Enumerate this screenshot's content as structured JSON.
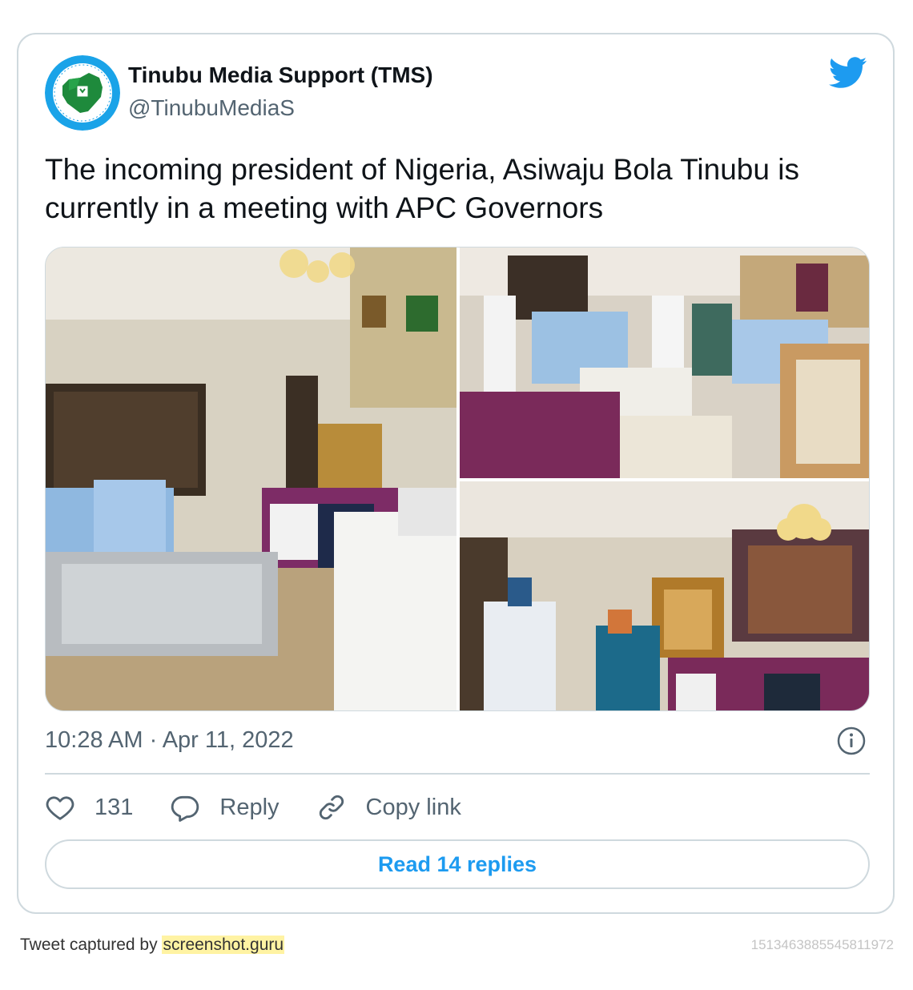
{
  "author": {
    "name": "Tinubu Media Support (TMS)",
    "handle": "@TinubuMediaS",
    "avatar_icon": "nigeria-map-emblem-icon"
  },
  "tweet": {
    "text": "The incoming president of Nigeria, Asiwaju Bola Tinubu is currently in a meeting with APC Governors",
    "timestamp": "10:28 AM · Apr 11, 2022"
  },
  "actions": {
    "likes": "131",
    "reply_label": "Reply",
    "copy_link_label": "Copy link"
  },
  "read_replies_label": "Read 14 replies",
  "footer": {
    "captured_by": "Tweet captured by",
    "site": "screenshot.guru",
    "tweet_id": "1513463885545811972"
  },
  "colors": {
    "twitter_blue": "#1d9bf0",
    "text": "#0f1419",
    "muted": "#536471",
    "border": "#cfd9de"
  }
}
